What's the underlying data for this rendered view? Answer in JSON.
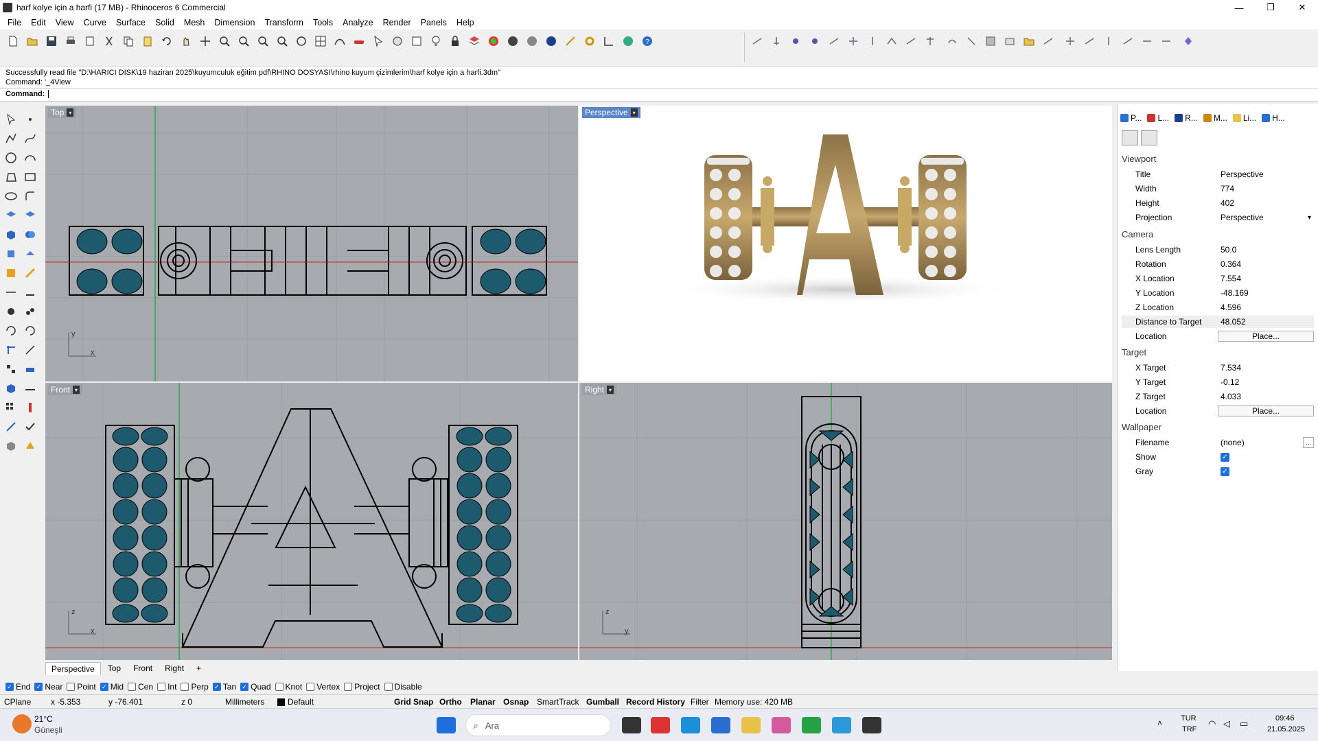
{
  "window": {
    "title": "harf kolye için a harfi (17 MB) - Rhinoceros 6 Commercial",
    "controls": [
      "—",
      "❐",
      "✕"
    ]
  },
  "menu": [
    "File",
    "Edit",
    "View",
    "Curve",
    "Surface",
    "Solid",
    "Mesh",
    "Dimension",
    "Transform",
    "Tools",
    "Analyze",
    "Render",
    "Panels",
    "Help"
  ],
  "command_history": [
    "Successfully read file \"D:\\HARICI DISK\\19 haziran 2025\\kuyumculuk eğitim pdf\\RHINO DOSYASI\\rhino kuyum çizimlerim\\harf kolye için a harfi.3dm\"",
    "Command: '_4View"
  ],
  "command_prompt": "Command:",
  "viewports": {
    "top": {
      "label": "Top"
    },
    "perspective": {
      "label": "Perspective"
    },
    "front": {
      "label": "Front"
    },
    "right": {
      "label": "Right"
    }
  },
  "axis_labels": {
    "top": [
      "y",
      "x"
    ],
    "front": [
      "z",
      "x"
    ],
    "right": [
      "z",
      "y"
    ]
  },
  "viewport_tabs": [
    "Perspective",
    "Top",
    "Front",
    "Right",
    "+"
  ],
  "panel": {
    "tabs": [
      "P...",
      "L...",
      "R...",
      "M...",
      "Li...",
      "H..."
    ],
    "viewport_section": "Viewport",
    "viewport_props": [
      {
        "k": "Title",
        "v": "Perspective"
      },
      {
        "k": "Width",
        "v": "774"
      },
      {
        "k": "Height",
        "v": "402"
      },
      {
        "k": "Projection",
        "v": "Perspective"
      }
    ],
    "camera_section": "Camera",
    "camera_props": [
      {
        "k": "Lens Length",
        "v": "50.0"
      },
      {
        "k": "Rotation",
        "v": "0.364"
      },
      {
        "k": "X Location",
        "v": "7.554"
      },
      {
        "k": "Y Location",
        "v": "-48.169"
      },
      {
        "k": "Z Location",
        "v": "4.596"
      },
      {
        "k": "Distance to Target",
        "v": "48.052"
      },
      {
        "k": "Location",
        "v": "Place..."
      }
    ],
    "target_section": "Target",
    "target_props": [
      {
        "k": "X Target",
        "v": "7.534"
      },
      {
        "k": "Y Target",
        "v": "-0.12"
      },
      {
        "k": "Z Target",
        "v": "4.033"
      },
      {
        "k": "Location",
        "v": "Place..."
      }
    ],
    "wallpaper_section": "Wallpaper",
    "wallpaper_props": [
      {
        "k": "Filename",
        "v": "(none)"
      },
      {
        "k": "Show",
        "v": "checked"
      },
      {
        "k": "Gray",
        "v": "checked"
      }
    ]
  },
  "osnaps": [
    {
      "label": "End",
      "on": true
    },
    {
      "label": "Near",
      "on": true
    },
    {
      "label": "Point",
      "on": false
    },
    {
      "label": "Mid",
      "on": true
    },
    {
      "label": "Cen",
      "on": false
    },
    {
      "label": "Int",
      "on": false
    },
    {
      "label": "Perp",
      "on": false
    },
    {
      "label": "Tan",
      "on": true
    },
    {
      "label": "Quad",
      "on": true
    },
    {
      "label": "Knot",
      "on": false
    },
    {
      "label": "Vertex",
      "on": false
    },
    {
      "label": "Project",
      "on": false
    },
    {
      "label": "Disable",
      "on": false
    }
  ],
  "status": {
    "cplane": "CPlane",
    "x": "x -5.353",
    "y": "y -76.401",
    "z": "z 0",
    "units": "Millimeters",
    "layer": "Default",
    "toggles": [
      "Grid Snap",
      "Ortho",
      "Planar",
      "Osnap",
      "SmartTrack",
      "Gumball",
      "Record History",
      "Filter"
    ],
    "memory": "Memory use: 420 MB"
  },
  "taskbar": {
    "weather_temp": "21°C",
    "weather_text": "Güneşli",
    "search": "Ara",
    "lang": "TUR",
    "lang2": "TRF",
    "time": "09:46",
    "date": "21.05.2025"
  },
  "colors": {
    "accent": "#1e6fd9",
    "gold": "#b8975a",
    "gem": "#1d5a6e"
  }
}
